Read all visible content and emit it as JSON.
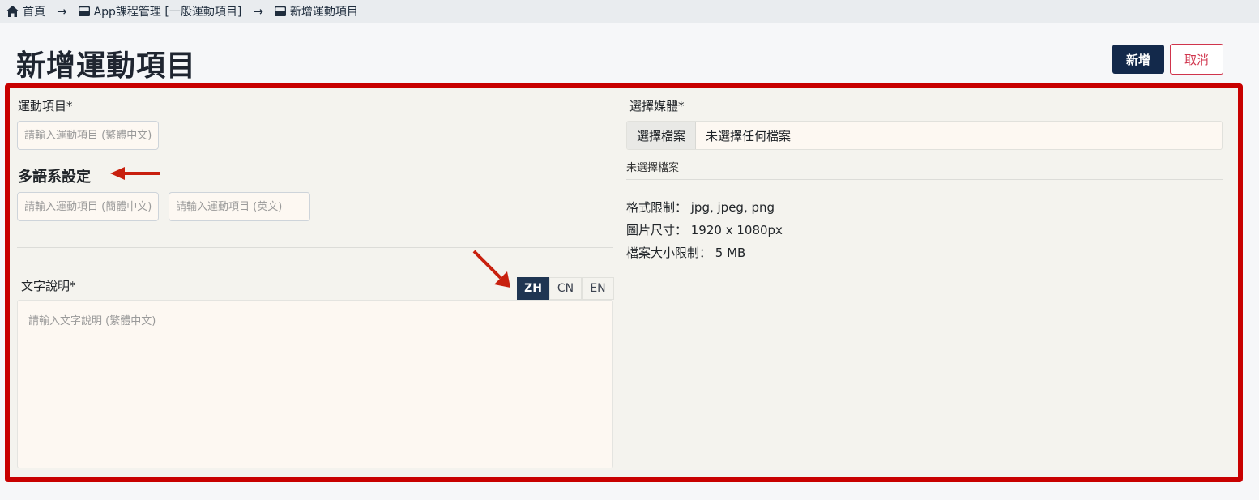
{
  "breadcrumb": {
    "items": [
      {
        "label": "首頁",
        "icon": "home-icon"
      },
      {
        "label": "App課程管理 [一般運動項目]",
        "icon": "window-icon"
      },
      {
        "label": "新增運動項目",
        "icon": "window-icon"
      }
    ],
    "separator": "→"
  },
  "page": {
    "title": "新增運動項目",
    "add_button": "新增",
    "cancel_button": "取消"
  },
  "form": {
    "exercise_label": "運動項目*",
    "exercise_placeholder": "請輸入運動項目 (繁體中文)",
    "multilang_title": "多語系設定",
    "exercise_cn_placeholder": "請輸入運動項目 (簡體中文)",
    "exercise_en_placeholder": "請輸入運動項目 (英文)",
    "description_label": "文字說明*",
    "description_placeholder": "請輸入文字說明 (繁體中文)",
    "lang_tabs": [
      "ZH",
      "CN",
      "EN"
    ],
    "active_lang": "ZH"
  },
  "media": {
    "label": "選擇媒體*",
    "choose_file_button": "選擇檔案",
    "no_file_selected": "未選擇任何檔案",
    "note": "未選擇檔案",
    "format_limit": "格式限制： jpg, jpeg, png",
    "image_size": "圖片尺寸： 1920 x 1080px",
    "file_size_limit": "檔案大小限制： 5 MB"
  },
  "colors": {
    "primary": "#13294b",
    "danger": "#d0344c",
    "highlight": "#c80000",
    "active_tab": "#1f3552"
  }
}
